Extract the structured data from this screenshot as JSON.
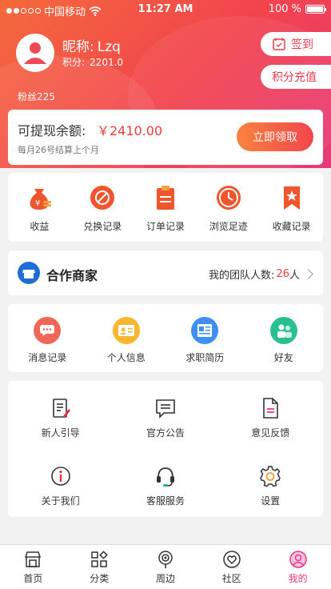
{
  "status_bar": {
    "carrier": "中国移动",
    "time": "11:27 AM",
    "battery": "100 %"
  },
  "profile": {
    "nickname_label": "昵称:",
    "nickname": "Lzq",
    "points_label": "积分:",
    "points": "2201.0",
    "fans": "粉丝225"
  },
  "actions": {
    "checkin": "签到",
    "recharge": "积分充值"
  },
  "balance": {
    "label": "可提现余额:",
    "value": "￥2410.00",
    "note": "每月26号结算上个月",
    "claim_button": "立即领取"
  },
  "quick_menu": [
    {
      "label": "收益",
      "icon": "money-bag-icon"
    },
    {
      "label": "兑换记录",
      "icon": "exchange-icon"
    },
    {
      "label": "订单记录",
      "icon": "clipboard-icon"
    },
    {
      "label": "浏览足迹",
      "icon": "clock-icon"
    },
    {
      "label": "收藏记录",
      "icon": "bookmark-icon"
    }
  ],
  "partner": {
    "title": "合作商家",
    "team_label": "我的团队人数:",
    "team_count": "26",
    "team_unit": "人"
  },
  "services": [
    {
      "label": "消息记录",
      "icon": "message-icon",
      "color": "#f2665a"
    },
    {
      "label": "个人信息",
      "icon": "id-card-icon",
      "color": "#f7b733"
    },
    {
      "label": "求职简历",
      "icon": "resume-icon",
      "color": "#3f8ef2"
    },
    {
      "label": "好友",
      "icon": "friends-icon",
      "color": "#28c08e"
    }
  ],
  "tools": [
    {
      "label": "新人引导",
      "icon": "guide-icon"
    },
    {
      "label": "官方公告",
      "icon": "announcement-icon"
    },
    {
      "label": "意见反馈",
      "icon": "feedback-icon"
    },
    {
      "label": "关于我们",
      "icon": "info-icon"
    },
    {
      "label": "客服服务",
      "icon": "headset-icon"
    },
    {
      "label": "设置",
      "icon": "gear-icon"
    }
  ],
  "tabs": [
    {
      "label": "首页",
      "icon": "shop-icon"
    },
    {
      "label": "分类",
      "icon": "category-icon"
    },
    {
      "label": "周边",
      "icon": "location-icon"
    },
    {
      "label": "社区",
      "icon": "community-icon"
    },
    {
      "label": "我的",
      "icon": "user-icon",
      "active": true
    }
  ],
  "colors": {
    "accent": "#ee3c4f",
    "gradient_start": "#f46a3b",
    "gradient_end": "#e73a7a",
    "active_tab": "#e6388a"
  }
}
